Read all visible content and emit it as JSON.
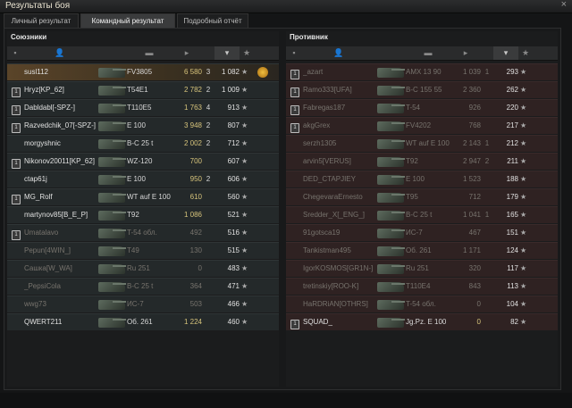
{
  "window": {
    "title": "Результаты боя",
    "close": "×"
  },
  "tabs": [
    {
      "label": "Личный результат",
      "active": false
    },
    {
      "label": "Командный результат",
      "active": true
    },
    {
      "label": "Подробный отчёт",
      "active": false
    }
  ],
  "allies": {
    "title": "Союзники",
    "rows": [
      {
        "name": "susl112",
        "tank": "FV3805",
        "dmg": "6 580",
        "kills": "3",
        "xp": "1 082",
        "platoon": false,
        "dead": false,
        "highlight": true,
        "medal": true
      },
      {
        "name": "Hryz[KP_62]",
        "tank": "T54E1",
        "dmg": "2 782",
        "kills": "2",
        "xp": "1 009",
        "platoon": true,
        "dead": false
      },
      {
        "name": "Dabldabl[-SPZ-]",
        "tank": "T110E5",
        "dmg": "1 763",
        "kills": "4",
        "xp": "913",
        "platoon": true,
        "dead": false
      },
      {
        "name": "Razvedchik_07[-SPZ-]",
        "tank": "E 100",
        "dmg": "3 948",
        "kills": "2",
        "xp": "807",
        "platoon": true,
        "dead": false
      },
      {
        "name": "morgyshnic",
        "tank": "B-C 25 t",
        "dmg": "2 002",
        "kills": "2",
        "xp": "712",
        "platoon": false,
        "dead": false
      },
      {
        "name": "Nikonov20011[KP_62]",
        "tank": "WZ-120",
        "dmg": "700",
        "kills": "",
        "xp": "607",
        "platoon": true,
        "dead": false
      },
      {
        "name": "ctap61j",
        "tank": "E 100",
        "dmg": "950",
        "kills": "2",
        "xp": "606",
        "platoon": false,
        "dead": false
      },
      {
        "name": "MG_Rolf",
        "tank": "WT auf E 100",
        "dmg": "610",
        "kills": "",
        "xp": "560",
        "platoon": true,
        "dead": false
      },
      {
        "name": "martynov85[B_E_P]",
        "tank": "T92",
        "dmg": "1 086",
        "kills": "",
        "xp": "521",
        "platoon": false,
        "dead": false
      },
      {
        "name": "Umatalavo",
        "tank": "T-54 обл.",
        "dmg": "492",
        "kills": "",
        "xp": "516",
        "platoon": true,
        "dead": true
      },
      {
        "name": "Pepun[4WIN_]",
        "tank": "T49",
        "dmg": "130",
        "kills": "",
        "xp": "515",
        "platoon": false,
        "dead": true
      },
      {
        "name": "Сашка[W_WA]",
        "tank": "Ru 251",
        "dmg": "0",
        "kills": "",
        "xp": "483",
        "platoon": false,
        "dead": true
      },
      {
        "name": "_PepsiCola",
        "tank": "B-C 25 t",
        "dmg": "364",
        "kills": "",
        "xp": "471",
        "platoon": false,
        "dead": true
      },
      {
        "name": "wwg73",
        "tank": "ИС-7",
        "dmg": "503",
        "kills": "",
        "xp": "466",
        "platoon": false,
        "dead": true
      },
      {
        "name": "QWERT211",
        "tank": "Об. 261",
        "dmg": "1 224",
        "kills": "",
        "xp": "460",
        "platoon": false,
        "dead": false
      }
    ]
  },
  "enemies": {
    "title": "Противник",
    "rows": [
      {
        "name": "_azart",
        "tank": "AMX 13 90",
        "dmg": "1 039",
        "kills": "1",
        "xp": "293",
        "platoon": true,
        "dead": true
      },
      {
        "name": "Ramo333[UFA]",
        "tank": "B-C 155 55",
        "dmg": "2 360",
        "kills": "",
        "xp": "262",
        "platoon": true,
        "dead": true
      },
      {
        "name": "Fabregas187",
        "tank": "T-54",
        "dmg": "926",
        "kills": "",
        "xp": "220",
        "platoon": true,
        "dead": true
      },
      {
        "name": "akgGrex",
        "tank": "FV4202",
        "dmg": "768",
        "kills": "",
        "xp": "217",
        "platoon": true,
        "dead": true
      },
      {
        "name": "serzh1305",
        "tank": "WT auf E 100",
        "dmg": "2 143",
        "kills": "1",
        "xp": "212",
        "platoon": false,
        "dead": true
      },
      {
        "name": "arvin5[VERUS]",
        "tank": "T92",
        "dmg": "2 947",
        "kills": "2",
        "xp": "211",
        "platoon": false,
        "dead": true
      },
      {
        "name": "DED_CTAPJIEY",
        "tank": "E 100",
        "dmg": "1 523",
        "kills": "",
        "xp": "188",
        "platoon": false,
        "dead": true
      },
      {
        "name": "ChegevaraErnesto",
        "tank": "T95",
        "dmg": "712",
        "kills": "",
        "xp": "179",
        "platoon": false,
        "dead": true
      },
      {
        "name": "Sredder_X[_ENG_]",
        "tank": "B-C 25 t",
        "dmg": "1 041",
        "kills": "1",
        "xp": "165",
        "platoon": false,
        "dead": true
      },
      {
        "name": "91gotsca19",
        "tank": "ИС-7",
        "dmg": "467",
        "kills": "",
        "xp": "151",
        "platoon": false,
        "dead": true
      },
      {
        "name": "Tankistman495",
        "tank": "Об. 261",
        "dmg": "1 171",
        "kills": "",
        "xp": "124",
        "platoon": false,
        "dead": true
      },
      {
        "name": "IgorKOSMOS[GR1N-]",
        "tank": "Ru 251",
        "dmg": "320",
        "kills": "",
        "xp": "117",
        "platoon": false,
        "dead": true
      },
      {
        "name": "tretinskiy[ROO-K]",
        "tank": "T110E4",
        "dmg": "843",
        "kills": "",
        "xp": "113",
        "platoon": false,
        "dead": true
      },
      {
        "name": "HaRDRiAN[OTHRS]",
        "tank": "T-54 обл.",
        "dmg": "0",
        "kills": "",
        "xp": "104",
        "platoon": false,
        "dead": true
      },
      {
        "name": "SQUAD_",
        "tank": "Jg.Pz. E 100",
        "dmg": "0",
        "kills": "",
        "xp": "82",
        "platoon": true,
        "dead": false
      }
    ]
  },
  "header_icons": [
    "square-icon",
    "player-icon",
    "tank-icon",
    "damage-icon",
    "kills-icon",
    "star-icon"
  ],
  "colors": {
    "accent": "#d6c37b",
    "ally_row": "#24292a",
    "enemy_row": "#2f2222"
  }
}
